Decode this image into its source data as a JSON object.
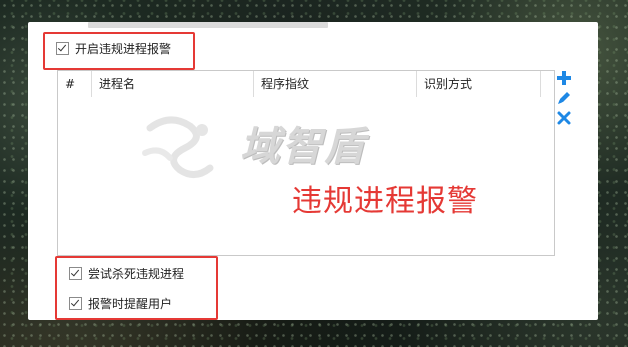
{
  "window": {
    "enable_alarm_label": "开启违规进程报警",
    "enable_alarm_checked": true
  },
  "table": {
    "columns": [
      "#",
      "进程名",
      "程序指纹",
      "识别方式"
    ],
    "rows": []
  },
  "toolbar": {
    "add_icon": "plus-icon",
    "edit_icon": "pencil-icon",
    "delete_icon": "close-icon",
    "accent_color": "#1e88e5"
  },
  "options": {
    "kill_process_label": "尝试杀死违规进程",
    "kill_process_checked": true,
    "notify_user_label": "报警时提醒用户",
    "notify_user_checked": true
  },
  "watermark": {
    "text": "域智盾"
  },
  "annotation": {
    "text": "违规进程报警",
    "color": "#e53935"
  }
}
